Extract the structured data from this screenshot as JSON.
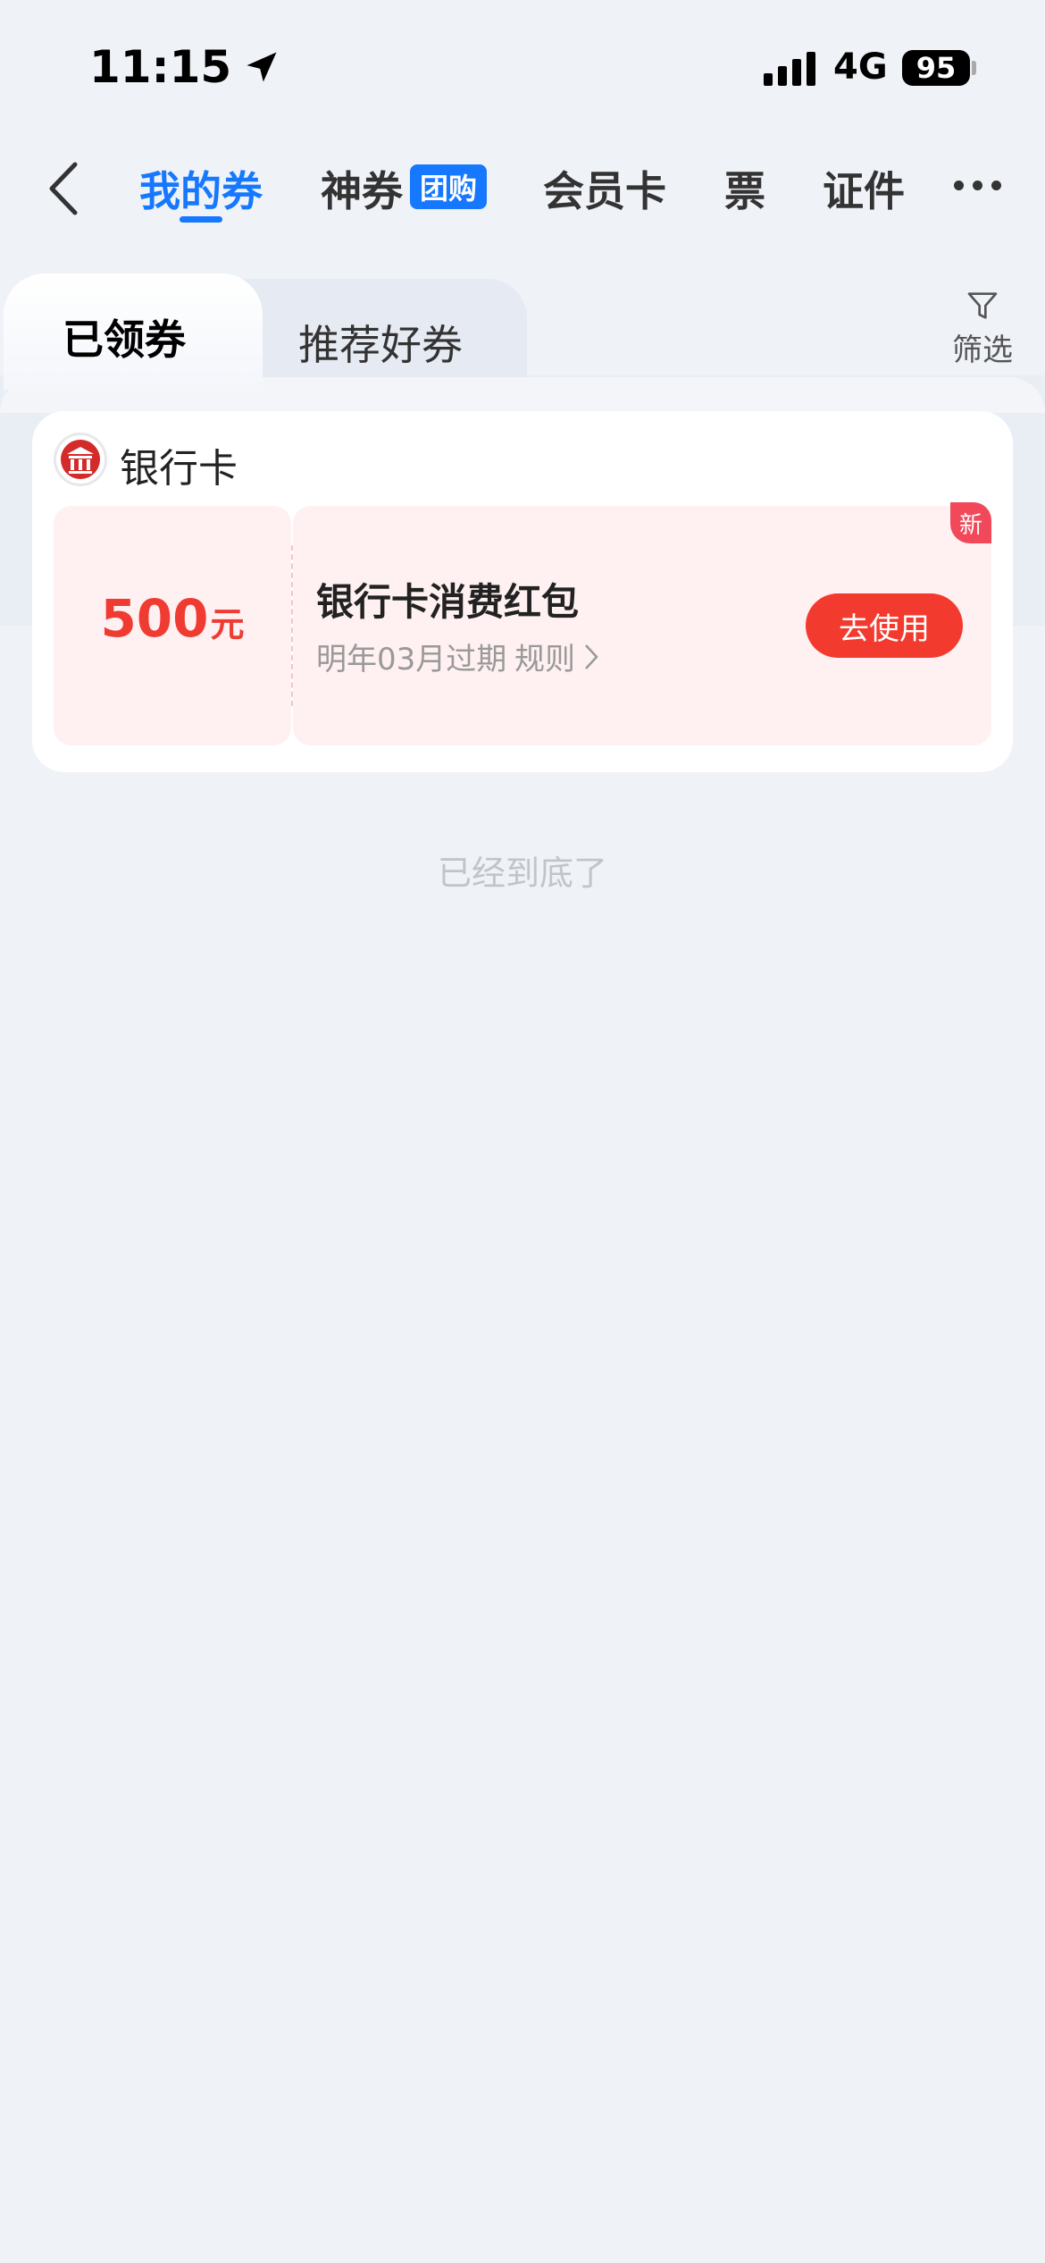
{
  "status_bar": {
    "time": "11:15",
    "network": "4G",
    "battery": "95"
  },
  "nav": {
    "tabs": [
      {
        "label": "我的券",
        "active": true
      },
      {
        "label": "神券",
        "badge": "团购"
      },
      {
        "label": "会员卡"
      },
      {
        "label": "票"
      },
      {
        "label": "证件"
      }
    ]
  },
  "sub_tabs": [
    {
      "label": "已领券",
      "active": true
    },
    {
      "label": "推荐好券"
    }
  ],
  "filter": {
    "label": "筛选"
  },
  "card": {
    "title": "银行卡",
    "coupon": {
      "amount": "500",
      "unit": "元",
      "title": "银行卡消费红包",
      "expire": "明年03月过期",
      "rule": "规则",
      "button": "去使用",
      "badge": "新"
    }
  },
  "end_text": "已经到底了",
  "colors": {
    "accent": "#1677ff",
    "red": "#f33a2e",
    "coupon_bg": "#fff0f1"
  }
}
